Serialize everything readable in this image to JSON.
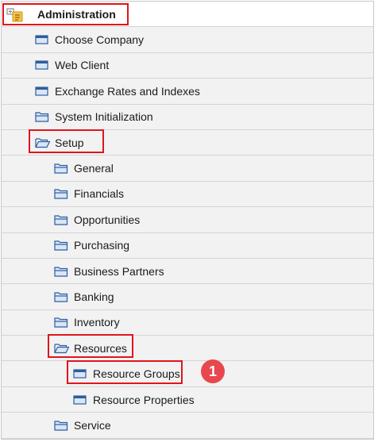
{
  "tree": {
    "root": {
      "label": "Administration"
    },
    "items": [
      {
        "label": "Choose Company"
      },
      {
        "label": "Web Client"
      },
      {
        "label": "Exchange Rates and Indexes"
      },
      {
        "label": "System Initialization"
      },
      {
        "label": "Setup"
      },
      {
        "label": "General"
      },
      {
        "label": "Financials"
      },
      {
        "label": "Opportunities"
      },
      {
        "label": "Purchasing"
      },
      {
        "label": "Business Partners"
      },
      {
        "label": "Banking"
      },
      {
        "label": "Inventory"
      },
      {
        "label": "Resources"
      },
      {
        "label": "Resource Groups"
      },
      {
        "label": "Resource Properties"
      },
      {
        "label": "Service"
      }
    ]
  },
  "callout": {
    "step": "1"
  },
  "colors": {
    "highlight": "#e0151b",
    "badge": "#e8474d",
    "window_icon": "#2e5d9e"
  }
}
